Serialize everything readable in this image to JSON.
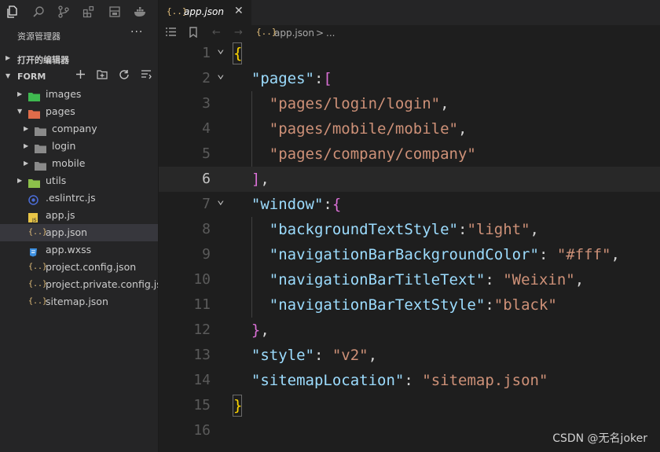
{
  "activity_bar": {
    "icons": [
      "files-icon",
      "search-icon",
      "source-control-icon",
      "extensions-icon",
      "layout-icon",
      "docker-icon"
    ]
  },
  "explorer": {
    "title": "资源管理器",
    "more": "···",
    "open_editors_label": "打开的编辑器",
    "folder_label": "FORM",
    "tree": [
      {
        "name": "images",
        "type": "folder",
        "color": "#3fb950",
        "indent": 0,
        "expanded": false
      },
      {
        "name": "pages",
        "type": "folder",
        "color": "#e06c4a",
        "indent": 0,
        "expanded": true
      },
      {
        "name": "company",
        "type": "folder",
        "color": "#8a8a8a",
        "indent": 1,
        "expanded": false
      },
      {
        "name": "login",
        "type": "folder",
        "color": "#8a8a8a",
        "indent": 1,
        "expanded": false
      },
      {
        "name": "mobile",
        "type": "folder",
        "color": "#8a8a8a",
        "indent": 1,
        "expanded": false
      },
      {
        "name": "utils",
        "type": "folder",
        "color": "#8cc04a",
        "indent": 0,
        "expanded": false
      },
      {
        "name": ".eslintrc.js",
        "type": "file",
        "color": "#4b6cd6",
        "indent": 0
      },
      {
        "name": "app.js",
        "type": "file",
        "color": "#e5c07b",
        "indent": 0
      },
      {
        "name": "app.json",
        "type": "file",
        "color": "#e5c07b",
        "indent": 0,
        "selected": true
      },
      {
        "name": "app.wxss",
        "type": "file",
        "color": "#3c8fe0",
        "indent": 0
      },
      {
        "name": "project.config.json",
        "type": "file",
        "color": "#e5c07b",
        "indent": 0
      },
      {
        "name": "project.private.config.js...",
        "type": "file",
        "color": "#e5c07b",
        "indent": 0
      },
      {
        "name": "sitemap.json",
        "type": "file",
        "color": "#e5c07b",
        "indent": 0
      }
    ]
  },
  "tab": {
    "icon": "{..}",
    "name": "app.json",
    "close": "✕"
  },
  "breadcrumb": {
    "icon": "{..}",
    "file": "app.json",
    "sep": ">",
    "more": "..."
  },
  "code": {
    "lines": [
      {
        "n": "1",
        "fold": true,
        "tokens": [
          {
            "t": "{",
            "c": "b1"
          }
        ]
      },
      {
        "n": "2",
        "fold": true,
        "tokens": [
          {
            "t": "  "
          },
          {
            "t": "\"pages\"",
            "c": "k"
          },
          {
            "t": ":",
            "c": "p"
          },
          {
            "t": "[",
            "c": "b2"
          }
        ]
      },
      {
        "n": "3",
        "tokens": [
          {
            "t": "    "
          },
          {
            "t": "\"pages/login/login\"",
            "c": "s"
          },
          {
            "t": ",",
            "c": "p"
          }
        ]
      },
      {
        "n": "4",
        "tokens": [
          {
            "t": "    "
          },
          {
            "t": "\"pages/mobile/mobile\"",
            "c": "s"
          },
          {
            "t": ",",
            "c": "p"
          }
        ]
      },
      {
        "n": "5",
        "tokens": [
          {
            "t": "    "
          },
          {
            "t": "\"pages/company/company\"",
            "c": "s"
          }
        ]
      },
      {
        "n": "6",
        "current": true,
        "tokens": [
          {
            "t": "  "
          },
          {
            "t": "]",
            "c": "b2"
          },
          {
            "t": ",",
            "c": "p"
          }
        ]
      },
      {
        "n": "7",
        "fold": true,
        "tokens": [
          {
            "t": "  "
          },
          {
            "t": "\"window\"",
            "c": "k"
          },
          {
            "t": ":",
            "c": "p"
          },
          {
            "t": "{",
            "c": "b2"
          }
        ]
      },
      {
        "n": "8",
        "tokens": [
          {
            "t": "    "
          },
          {
            "t": "\"backgroundTextStyle\"",
            "c": "k"
          },
          {
            "t": ":",
            "c": "p"
          },
          {
            "t": "\"light\"",
            "c": "s"
          },
          {
            "t": ",",
            "c": "p"
          }
        ]
      },
      {
        "n": "9",
        "tokens": [
          {
            "t": "    "
          },
          {
            "t": "\"navigationBarBackgroundColor\"",
            "c": "k"
          },
          {
            "t": ": ",
            "c": "p"
          },
          {
            "t": "\"#fff\"",
            "c": "s"
          },
          {
            "t": ",",
            "c": "p"
          }
        ]
      },
      {
        "n": "10",
        "tokens": [
          {
            "t": "    "
          },
          {
            "t": "\"navigationBarTitleText\"",
            "c": "k"
          },
          {
            "t": ": ",
            "c": "p"
          },
          {
            "t": "\"Weixin\"",
            "c": "s"
          },
          {
            "t": ",",
            "c": "p"
          }
        ]
      },
      {
        "n": "11",
        "tokens": [
          {
            "t": "    "
          },
          {
            "t": "\"navigationBarTextStyle\"",
            "c": "k"
          },
          {
            "t": ":",
            "c": "p"
          },
          {
            "t": "\"black\"",
            "c": "s"
          }
        ]
      },
      {
        "n": "12",
        "tokens": [
          {
            "t": "  "
          },
          {
            "t": "}",
            "c": "b2"
          },
          {
            "t": ",",
            "c": "p"
          }
        ]
      },
      {
        "n": "13",
        "tokens": [
          {
            "t": "  "
          },
          {
            "t": "\"style\"",
            "c": "k"
          },
          {
            "t": ": ",
            "c": "p"
          },
          {
            "t": "\"v2\"",
            "c": "s"
          },
          {
            "t": ",",
            "c": "p"
          }
        ]
      },
      {
        "n": "14",
        "tokens": [
          {
            "t": "  "
          },
          {
            "t": "\"sitemapLocation\"",
            "c": "k"
          },
          {
            "t": ": ",
            "c": "p"
          },
          {
            "t": "\"sitemap.json\"",
            "c": "s"
          }
        ]
      },
      {
        "n": "15",
        "tokens": [
          {
            "t": "}",
            "c": "b1"
          }
        ]
      },
      {
        "n": "16",
        "tokens": []
      }
    ]
  },
  "watermark": "CSDN @无名joker",
  "colors": {
    "key": "#9cdcfe",
    "string": "#ce9178",
    "bracket_outer": "#ffd700",
    "bracket_inner": "#da70d6",
    "background": "#1e1e1e",
    "sidebar": "#252526"
  }
}
